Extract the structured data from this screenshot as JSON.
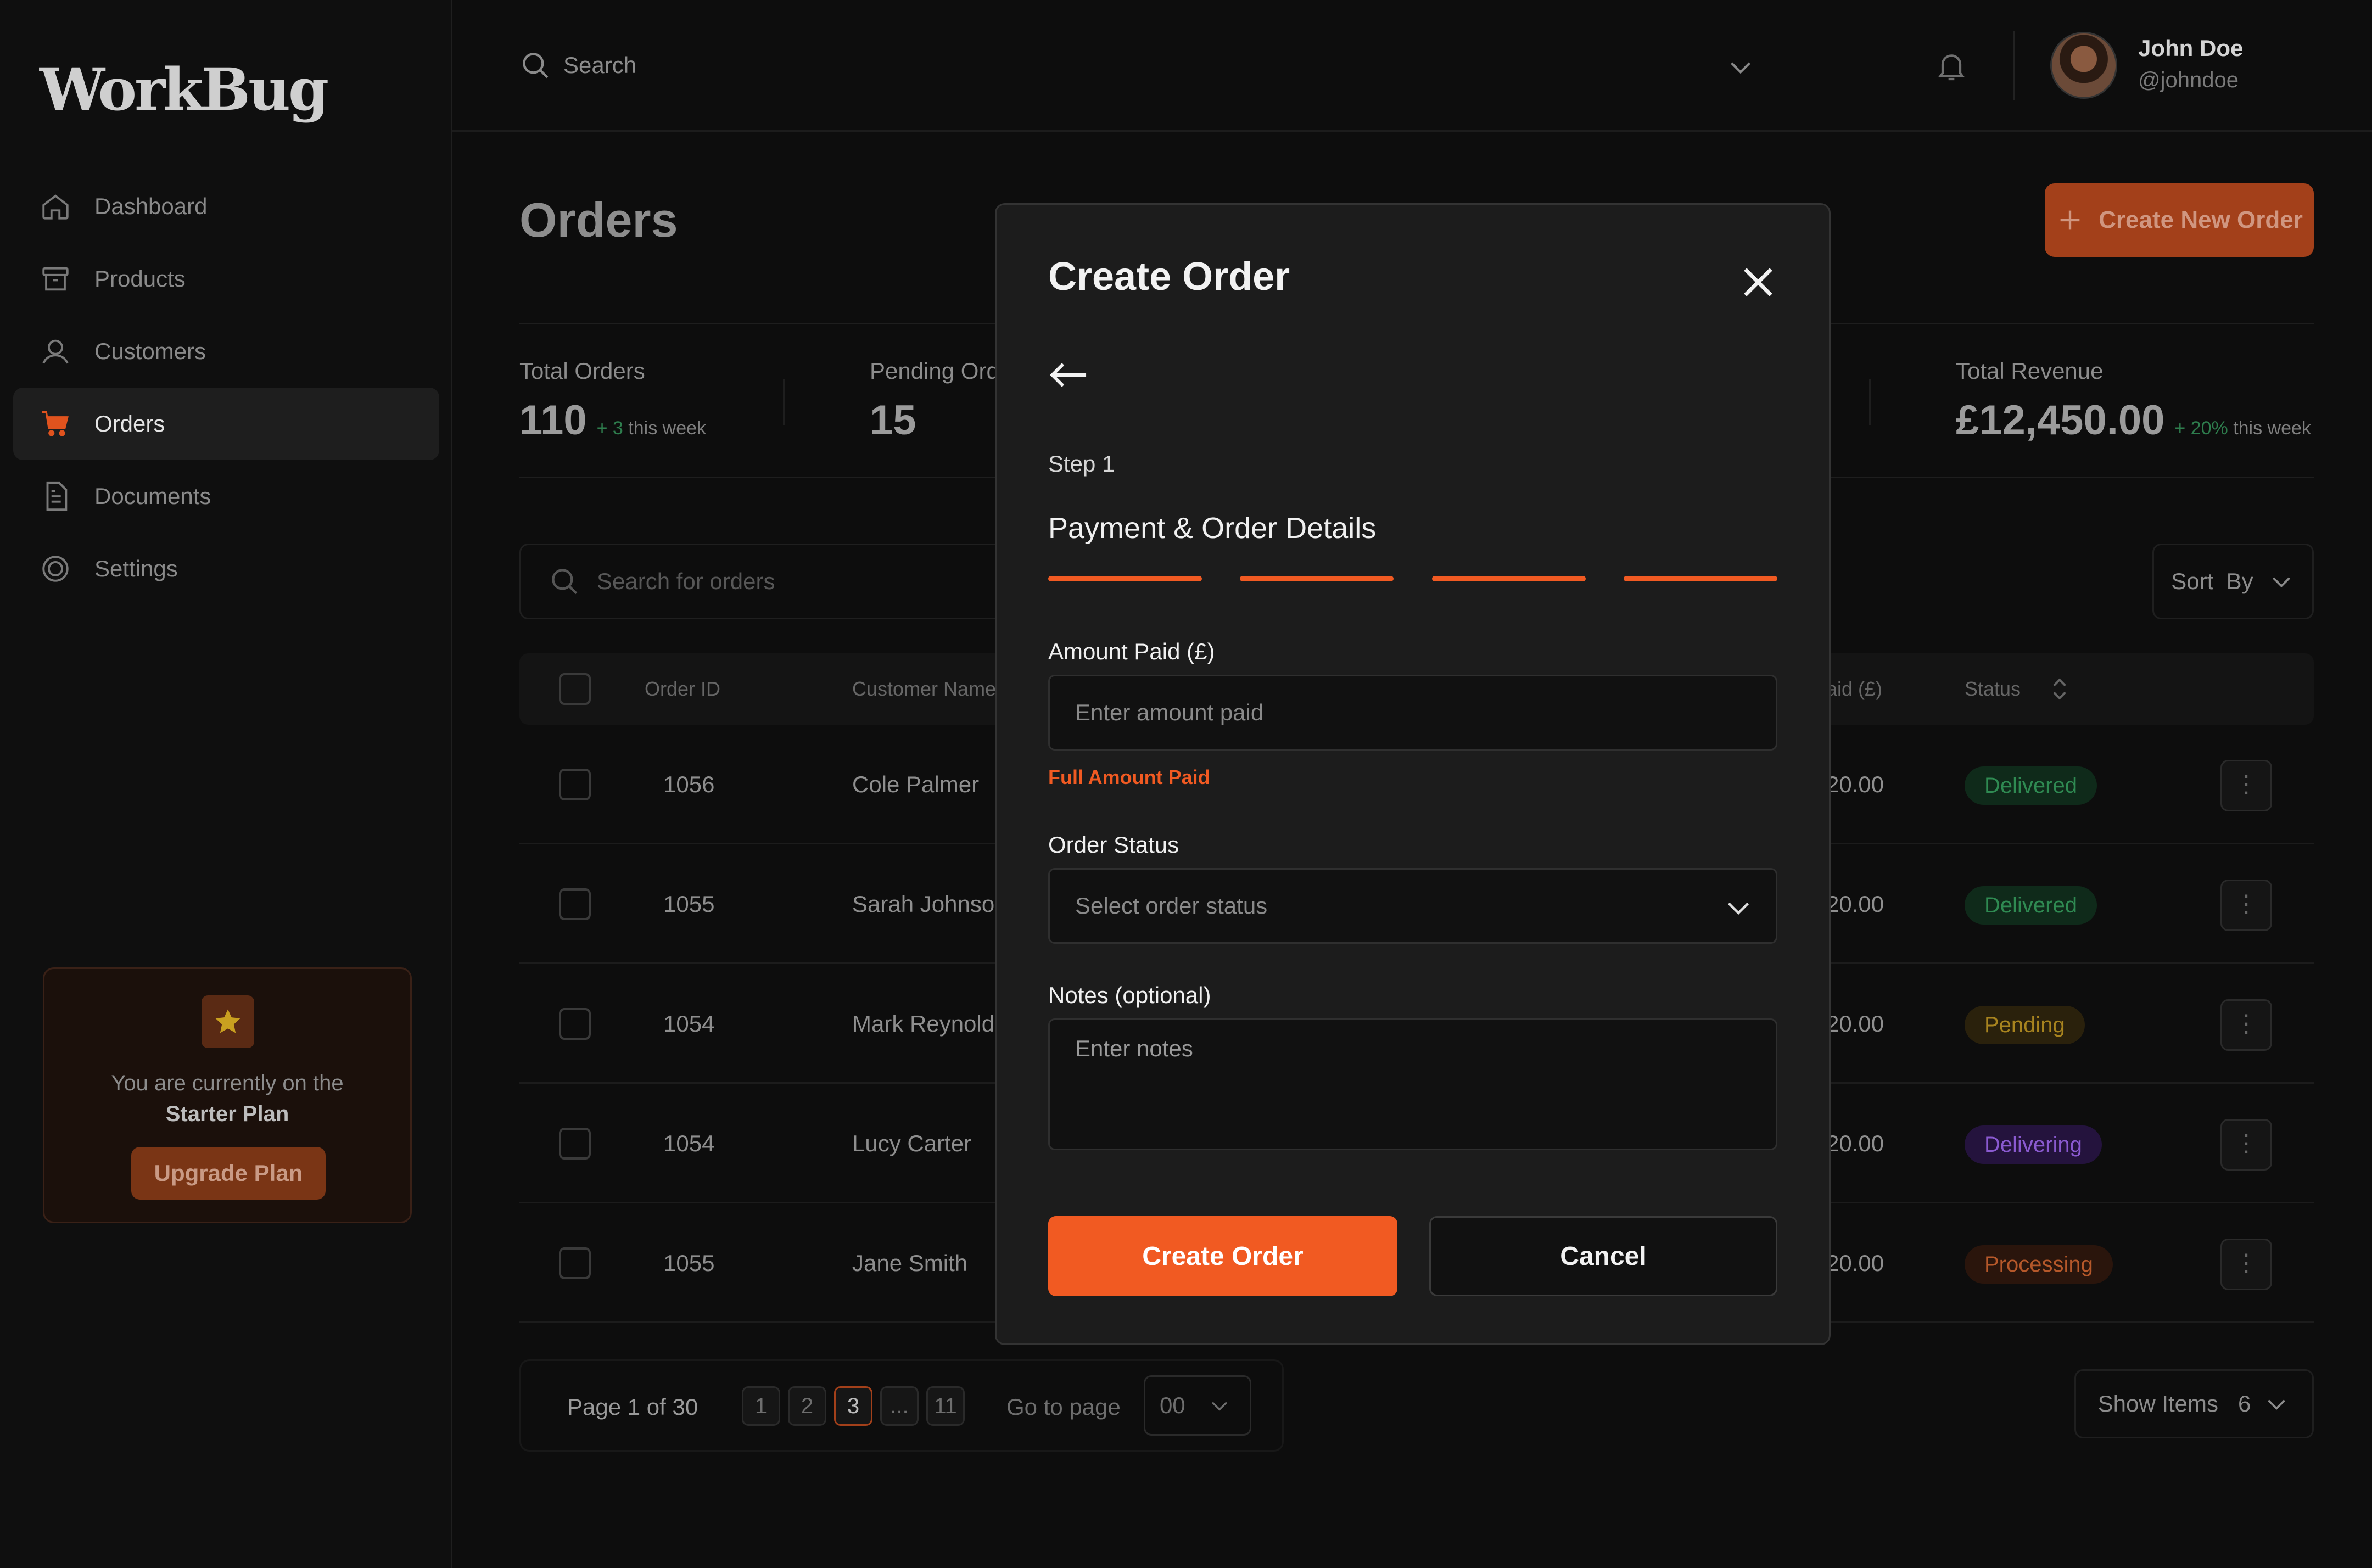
{
  "app": {
    "logo": "WorkBug"
  },
  "sidebar": {
    "items": [
      {
        "label": "Dashboard",
        "icon": "home-icon"
      },
      {
        "label": "Products",
        "icon": "box-icon"
      },
      {
        "label": "Customers",
        "icon": "user-icon"
      },
      {
        "label": "Orders",
        "icon": "cart-icon",
        "active": true
      },
      {
        "label": "Documents",
        "icon": "document-icon"
      },
      {
        "label": "Settings",
        "icon": "gear-icon"
      }
    ],
    "plan": {
      "line1": "You are currently on the",
      "plan_name": "Starter Plan",
      "upgrade_label": "Upgrade Plan"
    }
  },
  "header": {
    "search_label": "Search",
    "user": {
      "name": "John Doe",
      "handle": "@johndoe"
    }
  },
  "page": {
    "title": "Orders",
    "create_new_label": "Create New Order",
    "stats": [
      {
        "label": "Total Orders",
        "value": "110",
        "delta": "+ 3",
        "delta_suffix": "this week"
      },
      {
        "label": "Pending Ord",
        "value": "15"
      },
      {
        "label": "Total Revenue",
        "value": "£12,450.00",
        "delta": "+ 20%",
        "delta_suffix": "this week"
      }
    ],
    "search_placeholder": "Search for orders",
    "sort_label": "Sort  By"
  },
  "table": {
    "columns": {
      "order_id": "Order ID",
      "customer": "Customer Name",
      "paid": "aid (£)",
      "status": "Status"
    },
    "rows": [
      {
        "id": "1056",
        "customer": "Cole Palmer",
        "paid": "20.00",
        "status": "Delivered"
      },
      {
        "id": "1055",
        "customer": "Sarah Johnson",
        "paid": "20.00",
        "status": "Delivered"
      },
      {
        "id": "1054",
        "customer": "Mark Reynolds",
        "paid": "20.00",
        "status": "Pending"
      },
      {
        "id": "1054",
        "customer": "Lucy Carter",
        "paid": "20.00",
        "status": "Delivering"
      },
      {
        "id": "1055",
        "customer": "Jane Smith",
        "paid": "20.00",
        "status": "Processing"
      }
    ],
    "status_colors": {
      "Delivered": {
        "bg": "#0f2a1a",
        "fg": "#2f8a52"
      },
      "Pending": {
        "bg": "#2a210c",
        "fg": "#a8841f"
      },
      "Delivering": {
        "bg": "#24133d",
        "fg": "#8a5ad0"
      },
      "Processing": {
        "bg": "#2a150c",
        "fg": "#b5582a"
      }
    }
  },
  "pagination": {
    "page_text": "Page 1 of 30",
    "pages": [
      "1",
      "2",
      "3",
      "...",
      "11"
    ],
    "current": "3",
    "goto_label": "Go to page",
    "goto_value": "00",
    "show_items_label": "Show Items",
    "show_items_value": "6"
  },
  "modal": {
    "title": "Create Order",
    "step": "Step 1",
    "section": "Payment & Order Details",
    "progress_steps": 4,
    "amount_label": "Amount Paid (£)",
    "amount_placeholder": "Enter amount paid",
    "amount_hint": "Full Amount Paid",
    "status_label": "Order Status",
    "status_placeholder": "Select order status",
    "notes_label": "Notes (optional)",
    "notes_placeholder": "Enter notes",
    "create_label": "Create Order",
    "cancel_label": "Cancel",
    "accent": "#f15a22"
  }
}
